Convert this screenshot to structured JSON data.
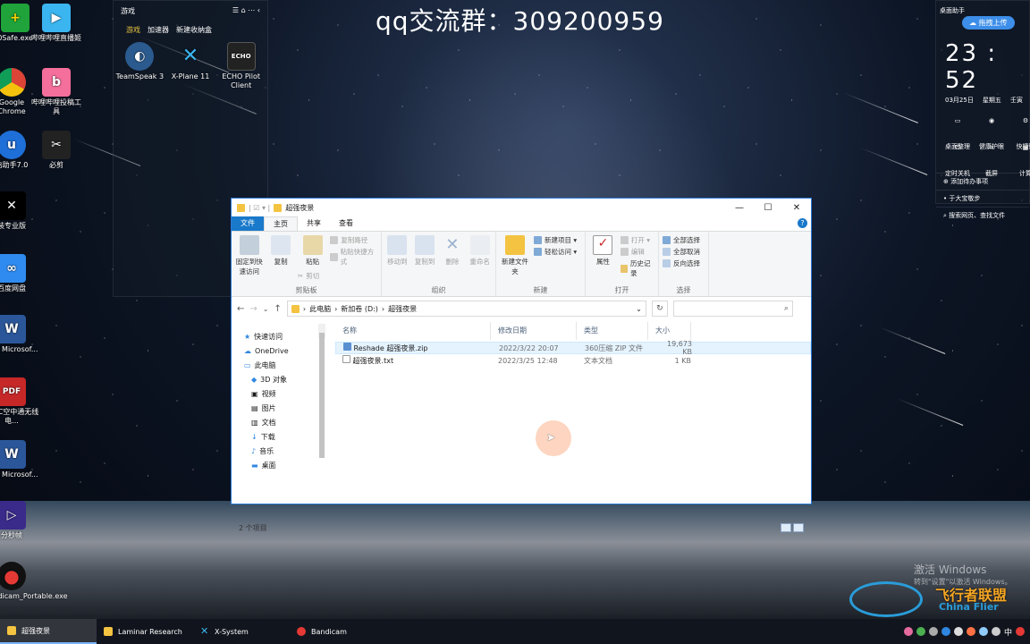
{
  "overlay_title": "qq交流群：309200959",
  "desktop_icons": [
    {
      "label": "0Safe.exe",
      "icon": "shield-plus-icon"
    },
    {
      "label": "哔哩哔哩直播姬",
      "icon": "bilibili-live-icon"
    },
    {
      "label": "Google Chrome",
      "icon": "chrome-icon"
    },
    {
      "label": "哔哩哔哩投稿工具",
      "icon": "bilibili-upload-icon"
    },
    {
      "label": "启助手7.0",
      "icon": "helper-icon"
    },
    {
      "label": "必剪",
      "icon": "bijian-icon"
    },
    {
      "label": "装专业版",
      "icon": "capcut-icon"
    },
    {
      "label": "百度网盘",
      "icon": "baidu-netdisk-icon"
    },
    {
      "label": "新建 Microsof...",
      "icon": "word-icon"
    },
    {
      "label": "TPRC空中通无线电...",
      "icon": "pdf-icon"
    },
    {
      "label": "新建 Microsof...",
      "icon": "word-icon"
    },
    {
      "label": "分秒帧",
      "icon": "framer-icon"
    },
    {
      "label": "Bandicam_Portable.exe",
      "icon": "bandicam-icon"
    }
  ],
  "fence": {
    "title": "游戏",
    "tabs": [
      "游戏",
      "加速器",
      "新建收纳盒"
    ],
    "icons": [
      {
        "label": "TeamSpeak 3"
      },
      {
        "label": "X-Plane 11"
      },
      {
        "label": "ECHO Pilot Client"
      }
    ]
  },
  "widget": {
    "title": "桌面助手",
    "upload": "拖拽上传",
    "time": "23 : 52",
    "date": "03月25日",
    "weekday": "星期五",
    "lunar": "壬寅",
    "actions": [
      "桌面整理",
      "健康护眼",
      "快捷键",
      "定时关机",
      "截屏",
      "计算"
    ],
    "todo": "添加待办事项",
    "todo_item": "于大宝敬步",
    "search": "搜索网页、查找文件"
  },
  "explorer": {
    "title": "超强夜景",
    "tabs": [
      "文件",
      "主页",
      "共享",
      "查看"
    ],
    "help": "?",
    "ribbon": {
      "clipboard": {
        "name": "剪贴板",
        "pin": "固定到快速访问",
        "copy": "复制",
        "paste": "粘贴",
        "copy_path": "复制路径",
        "paste_shortcut": "粘贴快捷方式",
        "cut": "剪切"
      },
      "organize": {
        "name": "组织",
        "move": "移动到",
        "copyto": "复制到",
        "delete": "删除",
        "rename": "重命名"
      },
      "new": {
        "name": "新建",
        "new_folder": "新建文件夹",
        "new_item": "新建项目 ▾",
        "easy_access": "轻松访问 ▾"
      },
      "open": {
        "name": "打开",
        "properties": "属性",
        "open": "打开 ▾",
        "edit": "编辑",
        "history": "历史记录"
      },
      "select": {
        "name": "选择",
        "all": "全部选择",
        "none": "全部取消",
        "invert": "反向选择"
      }
    },
    "breadcrumb": [
      "此电脑",
      "新加卷 (D:)",
      "超强夜景"
    ],
    "nav": [
      {
        "label": "快速访问",
        "icon": "star-icon"
      },
      {
        "label": "OneDrive",
        "icon": "cloud-icon"
      },
      {
        "label": "此电脑",
        "icon": "computer-icon"
      },
      {
        "label": "3D 对象",
        "icon": "cube-icon"
      },
      {
        "label": "视频",
        "icon": "video-icon"
      },
      {
        "label": "图片",
        "icon": "picture-icon"
      },
      {
        "label": "文档",
        "icon": "document-icon"
      },
      {
        "label": "下载",
        "icon": "download-icon"
      },
      {
        "label": "音乐",
        "icon": "music-icon"
      },
      {
        "label": "桌面",
        "icon": "desktop-icon"
      }
    ],
    "columns": [
      "名称",
      "修改日期",
      "类型",
      "大小"
    ],
    "files": [
      {
        "name": "Reshade 超强夜景.zip",
        "date": "2022/3/22 20:07",
        "type": "360压缩 ZIP 文件",
        "size": "19,673 KB"
      },
      {
        "name": "超强夜景.txt",
        "date": "2022/3/25 12:48",
        "type": "文本文档",
        "size": "1 KB"
      }
    ],
    "status": "2 个项目"
  },
  "taskbar": [
    {
      "label": "超强夜景",
      "active": true
    },
    {
      "label": "Laminar Research",
      "active": false
    },
    {
      "label": "X-System",
      "active": false
    },
    {
      "label": "Bandicam",
      "active": false
    }
  ],
  "tray_ime": "中",
  "activation": {
    "line1": "激活 Windows",
    "line2": "转到\"设置\"以激活 Windows。"
  },
  "logo": {
    "cn": "飞行者联盟",
    "en": "China Flier"
  }
}
